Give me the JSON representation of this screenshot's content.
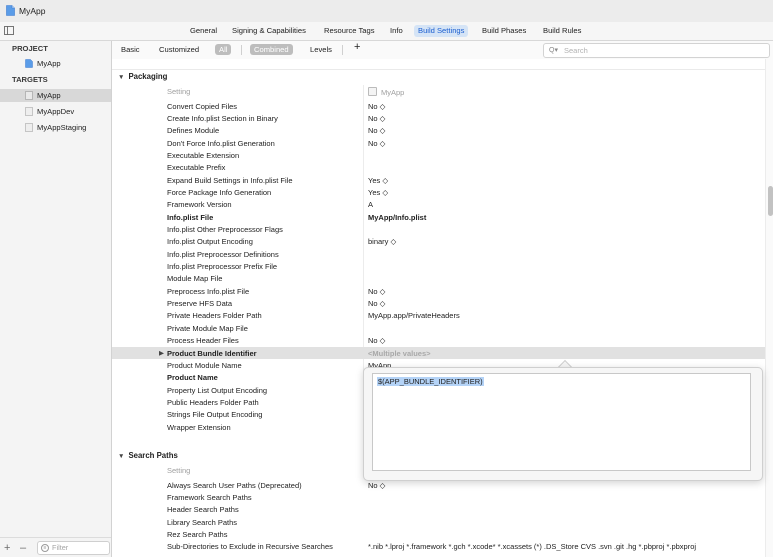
{
  "window": {
    "title": "MyApp"
  },
  "tabs": [
    {
      "label": "General"
    },
    {
      "label": "Signing & Capabilities"
    },
    {
      "label": "Resource Tags"
    },
    {
      "label": "Info"
    },
    {
      "label": "Build Settings"
    },
    {
      "label": "Build Phases"
    },
    {
      "label": "Build Rules"
    }
  ],
  "sidebar": {
    "project_heading": "PROJECT",
    "project_item": "MyApp",
    "targets_heading": "TARGETS",
    "targets": [
      "MyApp",
      "MyAppDev",
      "MyAppStaging"
    ],
    "filter_placeholder": "Filter"
  },
  "filterbar": {
    "basic": "Basic",
    "customized": "Customized",
    "all": "All",
    "combined": "Combined",
    "levels": "Levels",
    "add": "+",
    "search_placeholder": "Search"
  },
  "columns": {
    "setting": "Setting",
    "target": "MyApp"
  },
  "sections": {
    "packaging": "Packaging",
    "search_paths": "Search Paths"
  },
  "packaging_rows": [
    {
      "name": "Convert Copied Files",
      "value": "No ◇"
    },
    {
      "name": "Create Info.plist Section in Binary",
      "value": "No ◇"
    },
    {
      "name": "Defines Module",
      "value": "No ◇"
    },
    {
      "name": "Don't Force Info.plist Generation",
      "value": "No ◇"
    },
    {
      "name": "Executable Extension",
      "value": ""
    },
    {
      "name": "Executable Prefix",
      "value": ""
    },
    {
      "name": "Expand Build Settings in Info.plist File",
      "value": "Yes ◇"
    },
    {
      "name": "Force Package Info Generation",
      "value": "Yes ◇"
    },
    {
      "name": "Framework Version",
      "value": "A"
    },
    {
      "name": "Info.plist File",
      "value": "MyApp/Info.plist"
    },
    {
      "name": "Info.plist Other Preprocessor Flags",
      "value": ""
    },
    {
      "name": "Info.plist Output Encoding",
      "value": "binary ◇"
    },
    {
      "name": "Info.plist Preprocessor Definitions",
      "value": ""
    },
    {
      "name": "Info.plist Preprocessor Prefix File",
      "value": ""
    },
    {
      "name": "Module Map File",
      "value": ""
    },
    {
      "name": "Preprocess Info.plist File",
      "value": "No ◇"
    },
    {
      "name": "Preserve HFS Data",
      "value": "No ◇"
    },
    {
      "name": "Private Headers Folder Path",
      "value": "MyApp.app/PrivateHeaders"
    },
    {
      "name": "Private Module Map File",
      "value": ""
    },
    {
      "name": "Process Header Files",
      "value": "No ◇"
    },
    {
      "name": "Product Bundle Identifier",
      "value": "<Multiple values>"
    },
    {
      "name": "Product Module Name",
      "value": "MyApp"
    },
    {
      "name": "Product Name",
      "value": ""
    },
    {
      "name": "Property List Output Encoding",
      "value": ""
    },
    {
      "name": "Public Headers Folder Path",
      "value": ""
    },
    {
      "name": "Strings File Output Encoding",
      "value": ""
    },
    {
      "name": "Wrapper Extension",
      "value": ""
    }
  ],
  "search_rows": [
    {
      "name": "Always Search User Paths (Deprecated)",
      "value": "No ◇"
    },
    {
      "name": "Framework Search Paths",
      "value": ""
    },
    {
      "name": "Header Search Paths",
      "value": ""
    },
    {
      "name": "Library Search Paths",
      "value": ""
    },
    {
      "name": "Rez Search Paths",
      "value": ""
    },
    {
      "name": "Sub-Directories to Exclude in Recursive Searches",
      "value": "*.nib *.lproj *.framework *.gch *.xcode* *.xcassets (*) .DS_Store CVS .svn .git .hg *.pbproj *.pbxproj"
    }
  ],
  "popover": {
    "text": "$(APP_BUNDLE_IDENTIFIER)"
  }
}
